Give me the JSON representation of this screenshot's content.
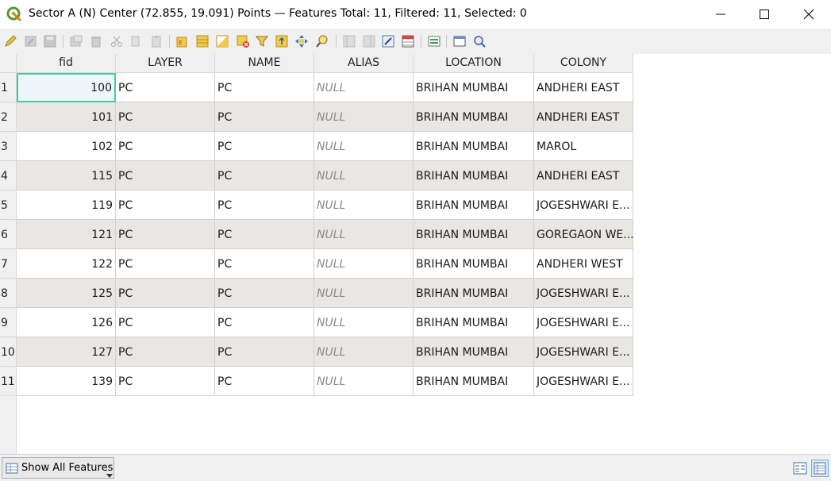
{
  "window": {
    "title": "Sector A (N) Center (72.855, 19.091) Points — Features Total: 11, Filtered: 11, Selected: 0"
  },
  "toolbar": {
    "icons": [
      "toggle-editing-icon",
      "multi-edit-icon",
      "save-edits-icon",
      "reload-icon",
      "add-feature-icon",
      "delete-feature-icon",
      "cut-icon",
      "copy-icon",
      "paste-icon",
      "expression-select-icon",
      "select-all-icon",
      "invert-selection-icon",
      "deselect-all-icon",
      "filter-selection-icon",
      "move-selection-top-icon",
      "pan-to-selection-icon",
      "zoom-to-selection-icon",
      "new-field-icon",
      "delete-field-icon",
      "field-calculator-icon",
      "conditional-formatting-icon",
      "actions-icon",
      "dock-icon",
      "zoom-map-icon"
    ]
  },
  "table": {
    "columns": [
      "fid",
      "LAYER",
      "NAME",
      "ALIAS",
      "LOCATION",
      "COLONY"
    ],
    "rows": [
      {
        "n": "1",
        "fid": "100",
        "layer": "PC",
        "name": "PC",
        "alias": "NULL",
        "location": "BRIHAN MUMBAI",
        "colony": "ANDHERI EAST"
      },
      {
        "n": "2",
        "fid": "101",
        "layer": "PC",
        "name": "PC",
        "alias": "NULL",
        "location": "BRIHAN MUMBAI",
        "colony": "ANDHERI EAST"
      },
      {
        "n": "3",
        "fid": "102",
        "layer": "PC",
        "name": "PC",
        "alias": "NULL",
        "location": "BRIHAN MUMBAI",
        "colony": "MAROL"
      },
      {
        "n": "4",
        "fid": "115",
        "layer": "PC",
        "name": "PC",
        "alias": "NULL",
        "location": "BRIHAN MUMBAI",
        "colony": "ANDHERI EAST"
      },
      {
        "n": "5",
        "fid": "119",
        "layer": "PC",
        "name": "PC",
        "alias": "NULL",
        "location": "BRIHAN MUMBAI",
        "colony": "JOGESHWARI E..."
      },
      {
        "n": "6",
        "fid": "121",
        "layer": "PC",
        "name": "PC",
        "alias": "NULL",
        "location": "BRIHAN MUMBAI",
        "colony": "GOREGAON WE..."
      },
      {
        "n": "7",
        "fid": "122",
        "layer": "PC",
        "name": "PC",
        "alias": "NULL",
        "location": "BRIHAN MUMBAI",
        "colony": "ANDHERI WEST"
      },
      {
        "n": "8",
        "fid": "125",
        "layer": "PC",
        "name": "PC",
        "alias": "NULL",
        "location": "BRIHAN MUMBAI",
        "colony": "JOGESHWARI E..."
      },
      {
        "n": "9",
        "fid": "126",
        "layer": "PC",
        "name": "PC",
        "alias": "NULL",
        "location": "BRIHAN MUMBAI",
        "colony": "JOGESHWARI E..."
      },
      {
        "n": "10",
        "fid": "127",
        "layer": "PC",
        "name": "PC",
        "alias": "NULL",
        "location": "BRIHAN MUMBAI",
        "colony": "JOGESHWARI E..."
      },
      {
        "n": "11",
        "fid": "139",
        "layer": "PC",
        "name": "PC",
        "alias": "NULL",
        "location": "BRIHAN MUMBAI",
        "colony": "JOGESHWARI E..."
      }
    ]
  },
  "statusbar": {
    "filter_button": "Show All Features"
  },
  "colors": {
    "accent_focus": "#3ed1a0",
    "row_alt": "#e9e7e3",
    "null_text": "#8a8a8a"
  }
}
